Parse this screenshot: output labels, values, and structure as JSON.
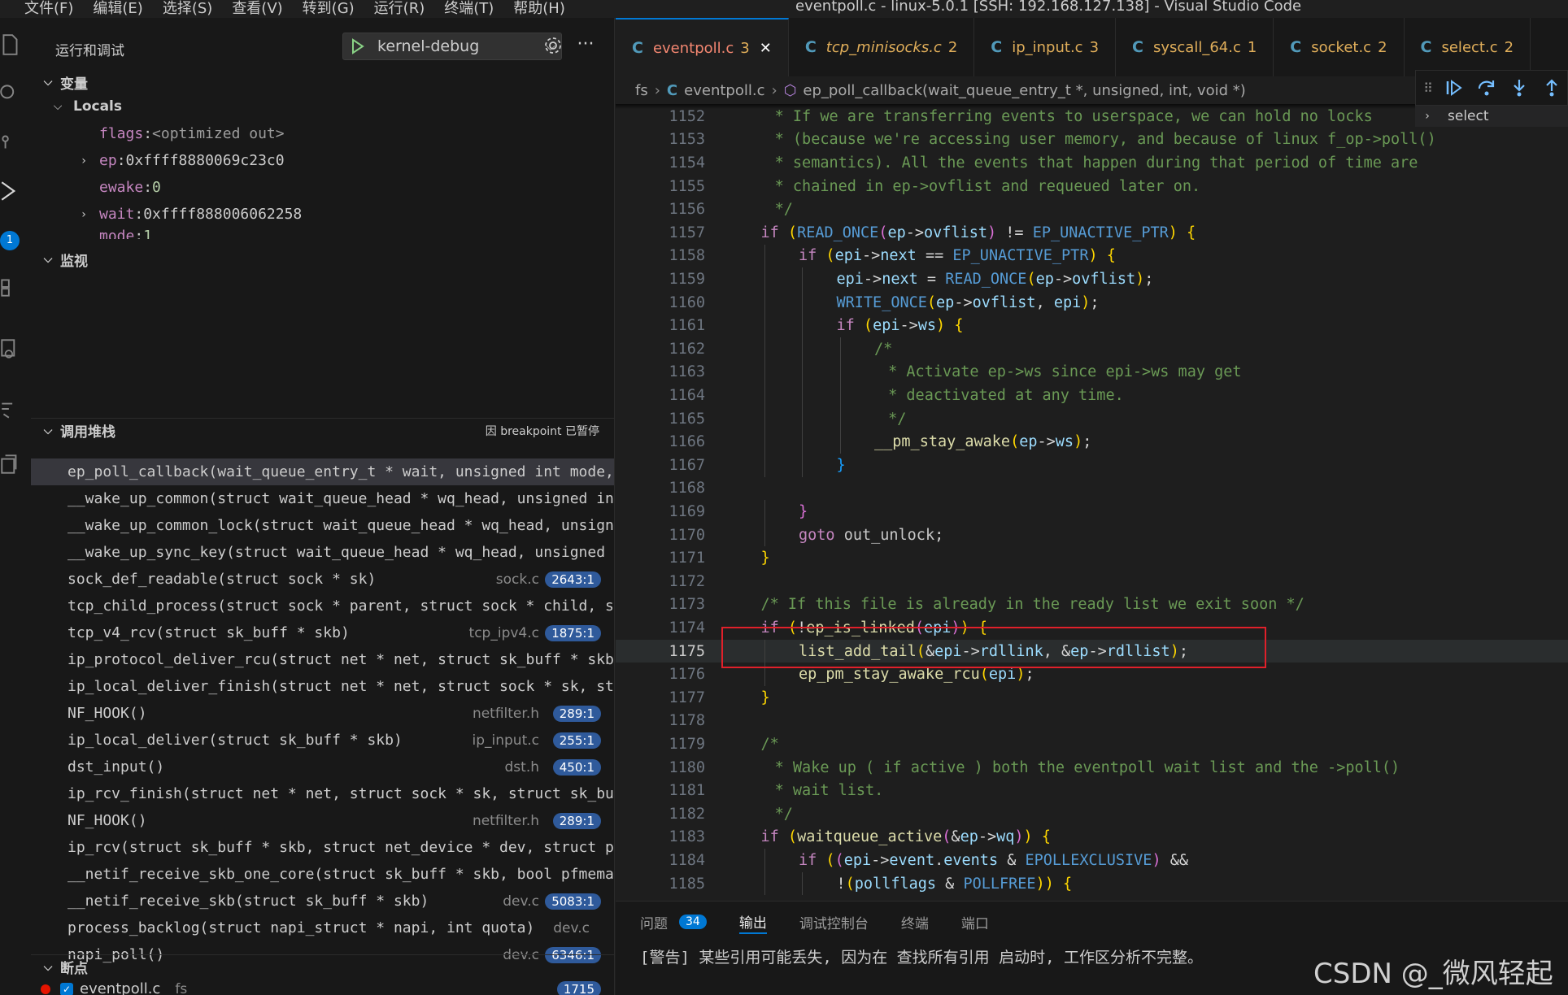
{
  "window": {
    "title": "eventpoll.c - linux-5.0.1 [SSH: 192.168.127.138] - Visual Studio Code",
    "menu": [
      "文件(F)",
      "编辑(E)",
      "选择(S)",
      "查看(V)",
      "转到(G)",
      "运行(R)",
      "终端(T)",
      "帮助(H)"
    ]
  },
  "activity_bar": {
    "icons": [
      "files-icon",
      "search-icon",
      "source-control-icon",
      "run-debug-icon",
      "extensions-icon",
      "remote-explorer-icon",
      "testing-icon",
      "docs-icon"
    ],
    "debug_badge": "1"
  },
  "sidebar": {
    "title": "运行和调试",
    "run_config": "kernel-debug",
    "variables": {
      "header": "变量",
      "locals_header": "Locals",
      "items": [
        {
          "name": "flags",
          "value": "<optimized out>",
          "expandable": false
        },
        {
          "name": "ep",
          "value": "0xffff8880069c23c0",
          "expandable": true
        },
        {
          "name": "ewake",
          "value": "0",
          "expandable": false
        },
        {
          "name": "wait",
          "value": "0xffff888006062258",
          "expandable": true
        },
        {
          "name": "mode",
          "value": "1",
          "expandable": false
        }
      ]
    },
    "watch": {
      "header": "监视"
    },
    "call_stack": {
      "header": "调用堆栈",
      "paused_label": "因 breakpoint 已暂停",
      "frames": [
        {
          "fn": "ep_poll_callback(wait_queue_entry_t * wait, unsigned int mode,",
          "file": "",
          "pos": ""
        },
        {
          "fn": "__wake_up_common(struct wait_queue_head * wq_head, unsigned int",
          "file": "",
          "pos": ""
        },
        {
          "fn": "__wake_up_common_lock(struct wait_queue_head * wq_head, unsigne",
          "file": "",
          "pos": ""
        },
        {
          "fn": "__wake_up_sync_key(struct wait_queue_head * wq_head, unsigned i",
          "file": "",
          "pos": ""
        },
        {
          "fn": "sock_def_readable(struct sock * sk)",
          "file": "sock.c",
          "pos": "2643:1"
        },
        {
          "fn": "tcp_child_process(struct sock * parent, struct sock * child, st",
          "file": "",
          "pos": ""
        },
        {
          "fn": "tcp_v4_rcv(struct sk_buff * skb)",
          "file": "tcp_ipv4.c",
          "pos": "1875:1"
        },
        {
          "fn": "ip_protocol_deliver_rcu(struct net * net, struct sk_buff * skb,",
          "file": "",
          "pos": ""
        },
        {
          "fn": "ip_local_deliver_finish(struct net * net, struct sock * sk, str",
          "file": "",
          "pos": ""
        },
        {
          "fn": "NF_HOOK()",
          "file": "netfilter.h",
          "pos": "289:1"
        },
        {
          "fn": "ip_local_deliver(struct sk_buff * skb)",
          "file": "ip_input.c",
          "pos": "255:1"
        },
        {
          "fn": "dst_input()",
          "file": "dst.h",
          "pos": "450:1"
        },
        {
          "fn": "ip_rcv_finish(struct net * net, struct sock * sk, struct sk_buf",
          "file": "",
          "pos": ""
        },
        {
          "fn": "NF_HOOK()",
          "file": "netfilter.h",
          "pos": "289:1"
        },
        {
          "fn": "ip_rcv(struct sk_buff * skb, struct net_device * dev, struct pa",
          "file": "",
          "pos": ""
        },
        {
          "fn": "__netif_receive_skb_one_core(struct sk_buff * skb, bool pfmemal",
          "file": "",
          "pos": ""
        },
        {
          "fn": "__netif_receive_skb(struct sk_buff * skb)",
          "file": "dev.c",
          "pos": "5083:1"
        },
        {
          "fn": "process_backlog(struct napi_struct * napi, int quota)",
          "file": "dev.c",
          "pos": ""
        },
        {
          "fn": "napi_poll()",
          "file": "dev.c",
          "pos": "6346:1"
        }
      ]
    },
    "breakpoints": {
      "header": "断点",
      "items": [
        {
          "file": "eventpoll.c",
          "dir": "fs",
          "line": "1715"
        }
      ]
    }
  },
  "editor": {
    "tabs": [
      {
        "name": "eventpoll.c",
        "count": "3",
        "active": true,
        "italic": false
      },
      {
        "name": "tcp_minisocks.c",
        "count": "2",
        "active": false,
        "italic": true
      },
      {
        "name": "ip_input.c",
        "count": "3",
        "active": false,
        "italic": false
      },
      {
        "name": "syscall_64.c",
        "count": "1",
        "active": false,
        "italic": false
      },
      {
        "name": "socket.c",
        "count": "2",
        "active": false,
        "italic": false
      },
      {
        "name": "select.c",
        "count": "2",
        "active": false,
        "italic": false
      }
    ],
    "breadcrumb": {
      "folder": "fs",
      "file": "eventpoll.c",
      "symbol": "ep_poll_callback(wait_queue_entry_t *, unsigned, int, void *)"
    },
    "current_line": "1175",
    "debug_toolbar_hint": "select",
    "lines": [
      {
        "n": "1152",
        "indent": 1
      },
      {
        "n": "1153",
        "indent": 1
      },
      {
        "n": "1154",
        "indent": 1
      },
      {
        "n": "1155",
        "indent": 1
      },
      {
        "n": "1156",
        "indent": 1
      },
      {
        "n": "1157",
        "indent": 1
      },
      {
        "n": "1158",
        "indent": 2
      },
      {
        "n": "1159",
        "indent": 3
      },
      {
        "n": "1160",
        "indent": 3
      },
      {
        "n": "1161",
        "indent": 3
      },
      {
        "n": "1162",
        "indent": 4
      },
      {
        "n": "1163",
        "indent": 4
      },
      {
        "n": "1164",
        "indent": 4
      },
      {
        "n": "1165",
        "indent": 4
      },
      {
        "n": "1166",
        "indent": 4
      },
      {
        "n": "1167",
        "indent": 3
      },
      {
        "n": "1168",
        "indent": 0
      },
      {
        "n": "1169",
        "indent": 2
      },
      {
        "n": "1170",
        "indent": 2
      },
      {
        "n": "1171",
        "indent": 1
      },
      {
        "n": "1172",
        "indent": 0
      },
      {
        "n": "1173",
        "indent": 1
      },
      {
        "n": "1174",
        "indent": 1
      },
      {
        "n": "1175",
        "indent": 2
      },
      {
        "n": "1176",
        "indent": 2
      },
      {
        "n": "1177",
        "indent": 1
      },
      {
        "n": "1178",
        "indent": 0
      },
      {
        "n": "1179",
        "indent": 1
      },
      {
        "n": "1180",
        "indent": 1
      },
      {
        "n": "1181",
        "indent": 1
      },
      {
        "n": "1182",
        "indent": 1
      },
      {
        "n": "1183",
        "indent": 1
      },
      {
        "n": "1184",
        "indent": 2
      },
      {
        "n": "1185",
        "indent": 3
      }
    ],
    "code_text": [
      " * If we are transferring events to userspace, we can hold no locks",
      " * (because we're accessing user memory, and because of linux f_op->poll()",
      " * semantics). All the events that happen during that period of time are",
      " * chained in ep->ovflist and requeued later on.",
      " */",
      "if (READ_ONCE(ep->ovflist) != EP_UNACTIVE_PTR) {",
      "if (epi->next == EP_UNACTIVE_PTR) {",
      "epi->next = READ_ONCE(ep->ovflist);",
      "WRITE_ONCE(ep->ovflist, epi);",
      "if (epi->ws) {",
      "/*",
      " * Activate ep->ws since epi->ws may get",
      " * deactivated at any time.",
      " */",
      "__pm_stay_awake(ep->ws);",
      "}",
      "",
      "}",
      "goto out_unlock;",
      "}",
      "",
      "/* If this file is already in the ready list we exit soon */",
      "if (!ep_is_linked(epi)) {",
      "list_add_tail(&epi->rdllink, &ep->rdllist);",
      "ep_pm_stay_awake_rcu(epi);",
      "}",
      "",
      "/*",
      " * Wake up ( if active ) both the eventpoll wait list and the ->poll()",
      " * wait list.",
      " */",
      "if (waitqueue_active(&ep->wq)) {",
      "if ((epi->event.events & EPOLLEXCLUSIVE) &&",
      "!(pollflags & POLLFREE)) {"
    ]
  },
  "panel": {
    "tabs": [
      {
        "label": "问题",
        "badge": "34",
        "active": false
      },
      {
        "label": "输出",
        "badge": "",
        "active": true
      },
      {
        "label": "调试控制台",
        "badge": "",
        "active": false
      },
      {
        "label": "终端",
        "badge": "",
        "active": false
      },
      {
        "label": "端口",
        "badge": "",
        "active": false
      }
    ],
    "message": "[警告] 某些引用可能丢失, 因为在 查找所有引用 启动时, 工作区分析不完整。"
  },
  "watermark": "CSDN @_微风轻起",
  "colors": {
    "accent": "#0078d4",
    "highlight_box": "#e0202a",
    "tab_active_text": "#f48771",
    "tab_text": "#e0ae5a"
  }
}
